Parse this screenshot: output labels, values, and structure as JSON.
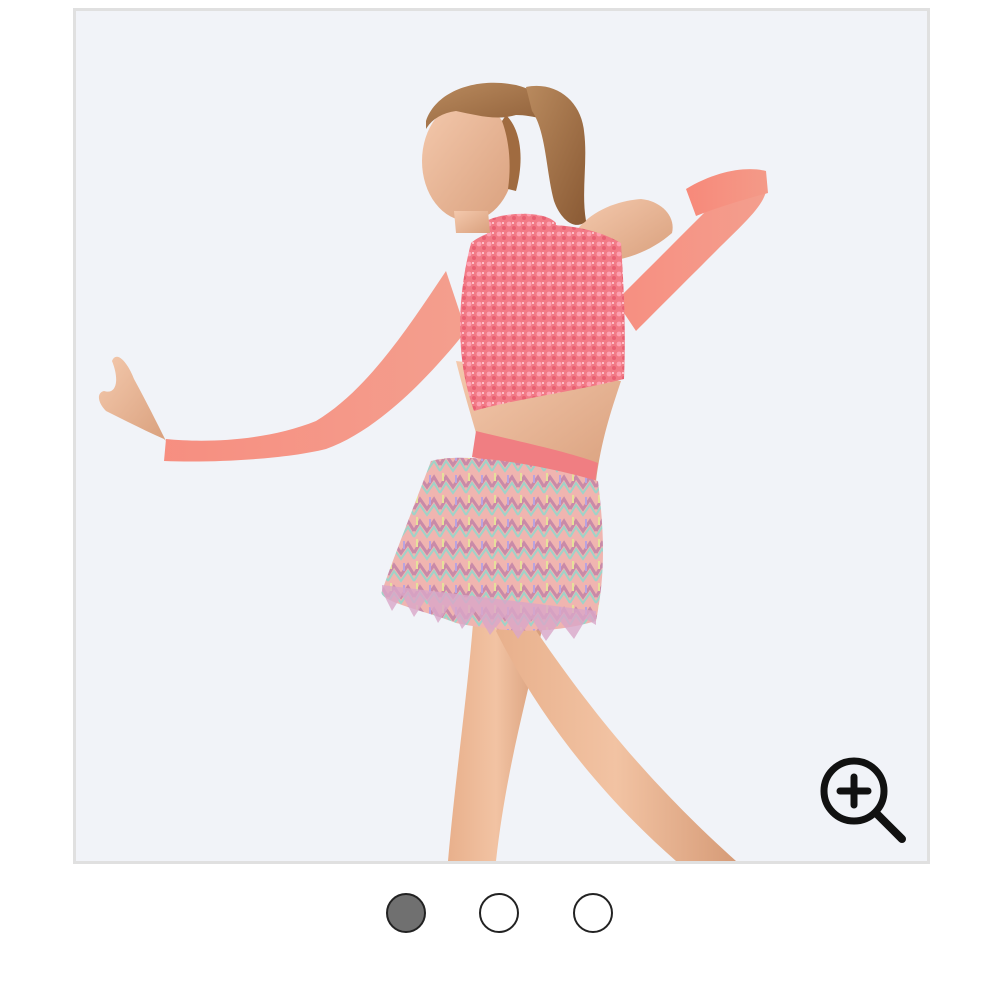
{
  "gallery": {
    "image": {
      "subject": "product-photo",
      "background": "#f1f3f8"
    },
    "zoom_icon": "zoom-in-icon",
    "pagination": {
      "total": 3,
      "active_index": 0,
      "active_color": "#707070",
      "inactive_color": "#ffffff"
    }
  }
}
